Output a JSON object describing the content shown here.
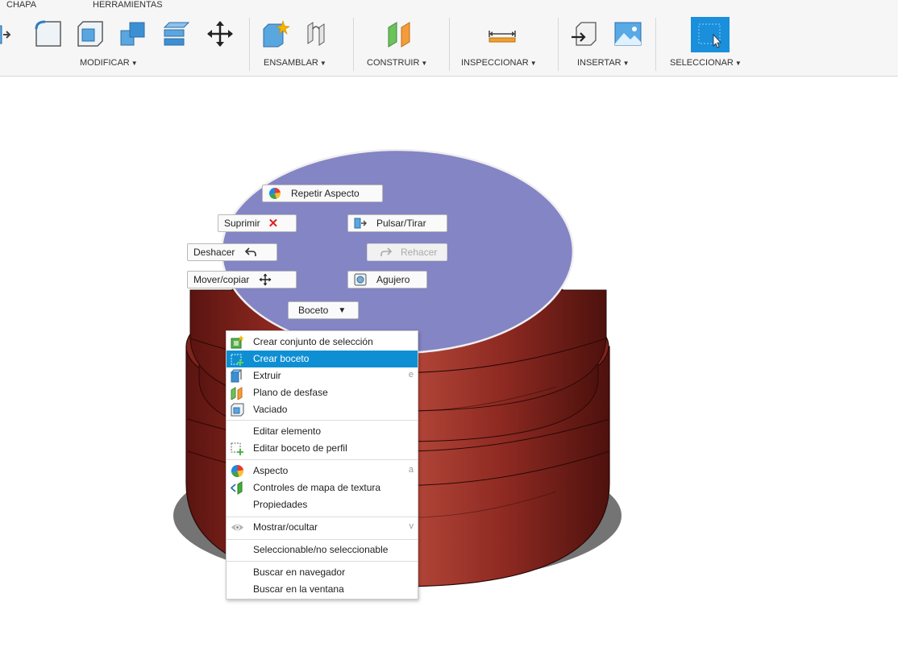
{
  "tabs": [
    "CHAPA",
    "HERRAMIENTAS"
  ],
  "toolbar": {
    "groups": {
      "modificar": "MODIFICAR",
      "ensamblar": "ENSAMBLAR",
      "construir": "CONSTRUIR",
      "inspeccionar": "INSPECCIONAR",
      "insertar": "INSERTAR",
      "seleccionar": "SELECCIONAR"
    }
  },
  "marking_menu": {
    "repetir_aspecto": "Repetir Aspecto",
    "suprimir": "Suprimir",
    "pulsar_tirar": "Pulsar/Tirar",
    "deshacer": "Deshacer",
    "rehacer": "Rehacer",
    "mover_copiar": "Mover/copiar",
    "agujero": "Agujero",
    "boceto": "Boceto"
  },
  "context_menu": {
    "items": [
      {
        "label": "Crear conjunto de selección",
        "shortcut": ""
      },
      {
        "label": "Crear boceto",
        "shortcut": ""
      },
      {
        "label": "Extruir",
        "shortcut": "e"
      },
      {
        "label": "Plano de desfase",
        "shortcut": ""
      },
      {
        "label": "Vaciado",
        "shortcut": ""
      },
      {
        "label": "Editar elemento",
        "shortcut": ""
      },
      {
        "label": "Editar boceto de perfil",
        "shortcut": ""
      },
      {
        "label": "Aspecto",
        "shortcut": "a"
      },
      {
        "label": "Controles de mapa de textura",
        "shortcut": ""
      },
      {
        "label": "Propiedades",
        "shortcut": ""
      },
      {
        "label": "Mostrar/ocultar",
        "shortcut": "v"
      },
      {
        "label": "Seleccionable/no seleccionable",
        "shortcut": ""
      },
      {
        "label": "Buscar en navegador",
        "shortcut": ""
      },
      {
        "label": "Buscar en la ventana",
        "shortcut": ""
      }
    ],
    "highlighted": "Crear boceto"
  },
  "colors": {
    "selection_accent": "#1a8fdb",
    "model_body": "#8e2a22",
    "selected_face": "#8385c4"
  }
}
